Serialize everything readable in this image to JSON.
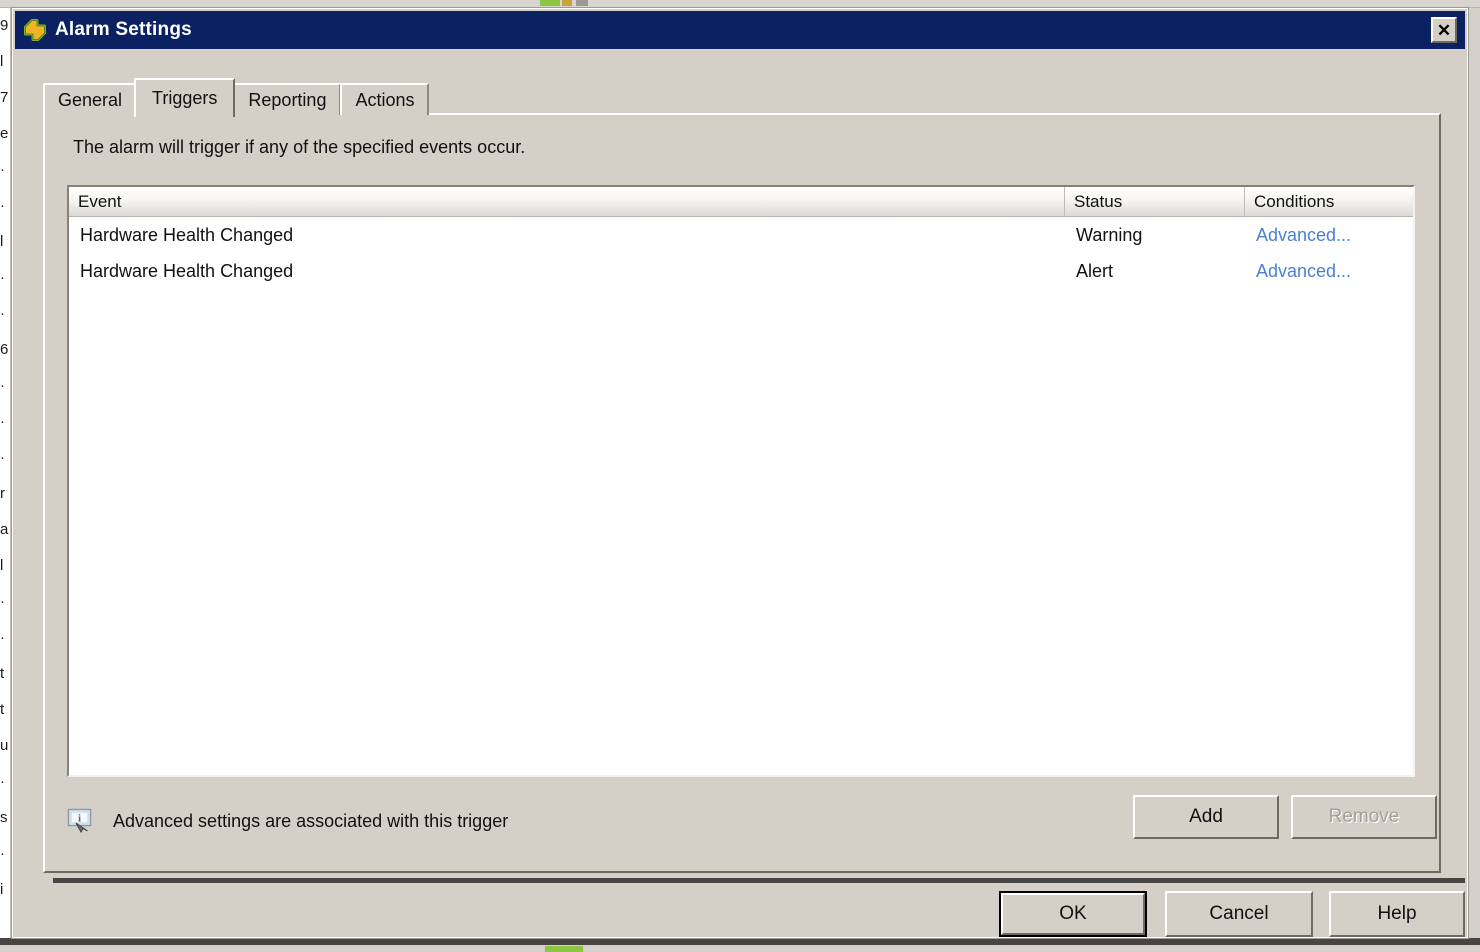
{
  "window": {
    "title": "Alarm Settings",
    "icon": "alarm-settings-icon",
    "close_label": "✕"
  },
  "tabs": [
    {
      "label": "General",
      "active": false
    },
    {
      "label": "Triggers",
      "active": true
    },
    {
      "label": "Reporting",
      "active": false
    },
    {
      "label": "Actions",
      "active": false
    }
  ],
  "triggers_tab": {
    "instruction": "The alarm will trigger if any of the specified events occur.",
    "columns": {
      "event": "Event",
      "status": "Status",
      "conditions": "Conditions"
    },
    "rows": [
      {
        "event": "Hardware Health Changed",
        "status": "Warning",
        "conditions": "Advanced..."
      },
      {
        "event": "Hardware Health Changed",
        "status": "Alert",
        "conditions": "Advanced..."
      }
    ],
    "note": {
      "icon": "info-monitor-icon",
      "text": "Advanced settings are associated with this trigger"
    },
    "add_label": "Add",
    "remove_label": "Remove"
  },
  "footer": {
    "ok_label": "OK",
    "cancel_label": "Cancel",
    "help_label": "Help"
  },
  "colors": {
    "titlebar": "#0b2161",
    "dialog_face": "#d4d0c8",
    "link": "#4a7fd4",
    "disabled_text": "#a3a09a",
    "accent_green": "#8ec641"
  },
  "background": {
    "left_margin_glyphs": [
      "9",
      "l",
      "7",
      "e",
      "·",
      "·",
      "l",
      "·",
      "·",
      "6",
      "·",
      "·",
      "·",
      "r",
      "a",
      "l",
      "·",
      "·",
      "t",
      "t",
      "u",
      "·",
      "s",
      "·",
      "i"
    ]
  }
}
